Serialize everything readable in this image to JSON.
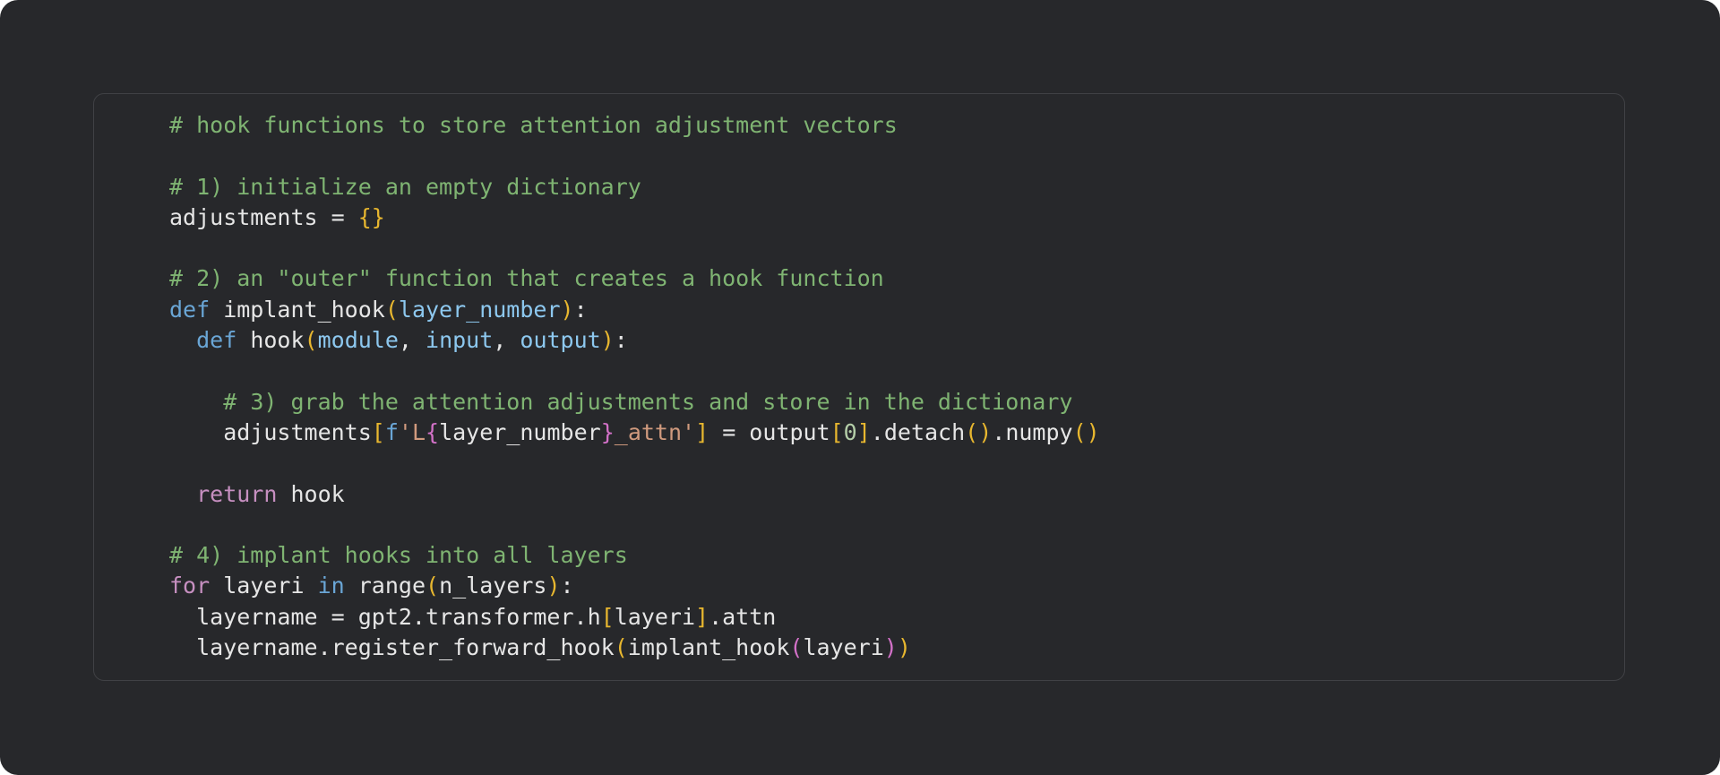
{
  "code": {
    "lines": [
      {
        "tokens": [
          {
            "t": "# hook functions to store attention adjustment vectors",
            "c": "comment"
          }
        ]
      },
      {
        "tokens": []
      },
      {
        "tokens": [
          {
            "t": "# 1) initialize an empty dictionary",
            "c": "comment"
          }
        ]
      },
      {
        "tokens": [
          {
            "t": "adjustments = ",
            "c": "name"
          },
          {
            "t": "{}",
            "c": "brace-gold"
          }
        ]
      },
      {
        "tokens": []
      },
      {
        "tokens": [
          {
            "t": "# 2) an \"outer\" function that creates a hook function",
            "c": "comment"
          }
        ]
      },
      {
        "tokens": [
          {
            "t": "def",
            "c": "keyword"
          },
          {
            "t": " implant_hook",
            "c": "name"
          },
          {
            "t": "(",
            "c": "brace-gold"
          },
          {
            "t": "layer_number",
            "c": "param"
          },
          {
            "t": ")",
            "c": "brace-gold"
          },
          {
            "t": ":",
            "c": "name"
          }
        ]
      },
      {
        "tokens": [
          {
            "t": "  ",
            "c": "name"
          },
          {
            "t": "def",
            "c": "keyword"
          },
          {
            "t": " hook",
            "c": "name"
          },
          {
            "t": "(",
            "c": "brace-gold"
          },
          {
            "t": "module",
            "c": "param"
          },
          {
            "t": ", ",
            "c": "name"
          },
          {
            "t": "input",
            "c": "param"
          },
          {
            "t": ", ",
            "c": "name"
          },
          {
            "t": "output",
            "c": "param"
          },
          {
            "t": ")",
            "c": "brace-gold"
          },
          {
            "t": ":",
            "c": "name"
          }
        ]
      },
      {
        "tokens": []
      },
      {
        "tokens": [
          {
            "t": "    ",
            "c": "name"
          },
          {
            "t": "# 3) grab the attention adjustments and store in the dictionary",
            "c": "comment"
          }
        ]
      },
      {
        "tokens": [
          {
            "t": "    adjustments",
            "c": "name"
          },
          {
            "t": "[",
            "c": "brace-gold"
          },
          {
            "t": "f",
            "c": "fprefix"
          },
          {
            "t": "'L",
            "c": "fstring"
          },
          {
            "t": "{",
            "c": "brace-pink"
          },
          {
            "t": "layer_number",
            "c": "name"
          },
          {
            "t": "}",
            "c": "brace-pink"
          },
          {
            "t": "_attn'",
            "c": "fstring"
          },
          {
            "t": "]",
            "c": "brace-gold"
          },
          {
            "t": " = output",
            "c": "name"
          },
          {
            "t": "[",
            "c": "brace-gold"
          },
          {
            "t": "0",
            "c": "number"
          },
          {
            "t": "]",
            "c": "brace-gold"
          },
          {
            "t": ".detach",
            "c": "name"
          },
          {
            "t": "()",
            "c": "brace-gold"
          },
          {
            "t": ".numpy",
            "c": "name"
          },
          {
            "t": "()",
            "c": "brace-gold"
          }
        ]
      },
      {
        "tokens": []
      },
      {
        "tokens": [
          {
            "t": "  ",
            "c": "name"
          },
          {
            "t": "return",
            "c": "keyword-ctl"
          },
          {
            "t": " hook",
            "c": "name"
          }
        ]
      },
      {
        "tokens": []
      },
      {
        "tokens": [
          {
            "t": "# 4) implant hooks into all layers",
            "c": "comment"
          }
        ]
      },
      {
        "tokens": [
          {
            "t": "for",
            "c": "keyword-ctl"
          },
          {
            "t": " layeri ",
            "c": "name"
          },
          {
            "t": "in",
            "c": "keyword"
          },
          {
            "t": " range",
            "c": "name"
          },
          {
            "t": "(",
            "c": "brace-gold"
          },
          {
            "t": "n_layers",
            "c": "name"
          },
          {
            "t": ")",
            "c": "brace-gold"
          },
          {
            "t": ":",
            "c": "name"
          }
        ]
      },
      {
        "tokens": [
          {
            "t": "  layername = gpt2.transformer.h",
            "c": "name"
          },
          {
            "t": "[",
            "c": "brace-gold"
          },
          {
            "t": "layeri",
            "c": "name"
          },
          {
            "t": "]",
            "c": "brace-gold"
          },
          {
            "t": ".attn",
            "c": "name"
          }
        ]
      },
      {
        "tokens": [
          {
            "t": "  layername.register_forward_hook",
            "c": "name"
          },
          {
            "t": "(",
            "c": "brace-gold"
          },
          {
            "t": "implant_hook",
            "c": "name"
          },
          {
            "t": "(",
            "c": "brace-pink"
          },
          {
            "t": "layeri",
            "c": "name"
          },
          {
            "t": ")",
            "c": "brace-pink"
          },
          {
            "t": ")",
            "c": "brace-gold"
          }
        ]
      }
    ]
  }
}
